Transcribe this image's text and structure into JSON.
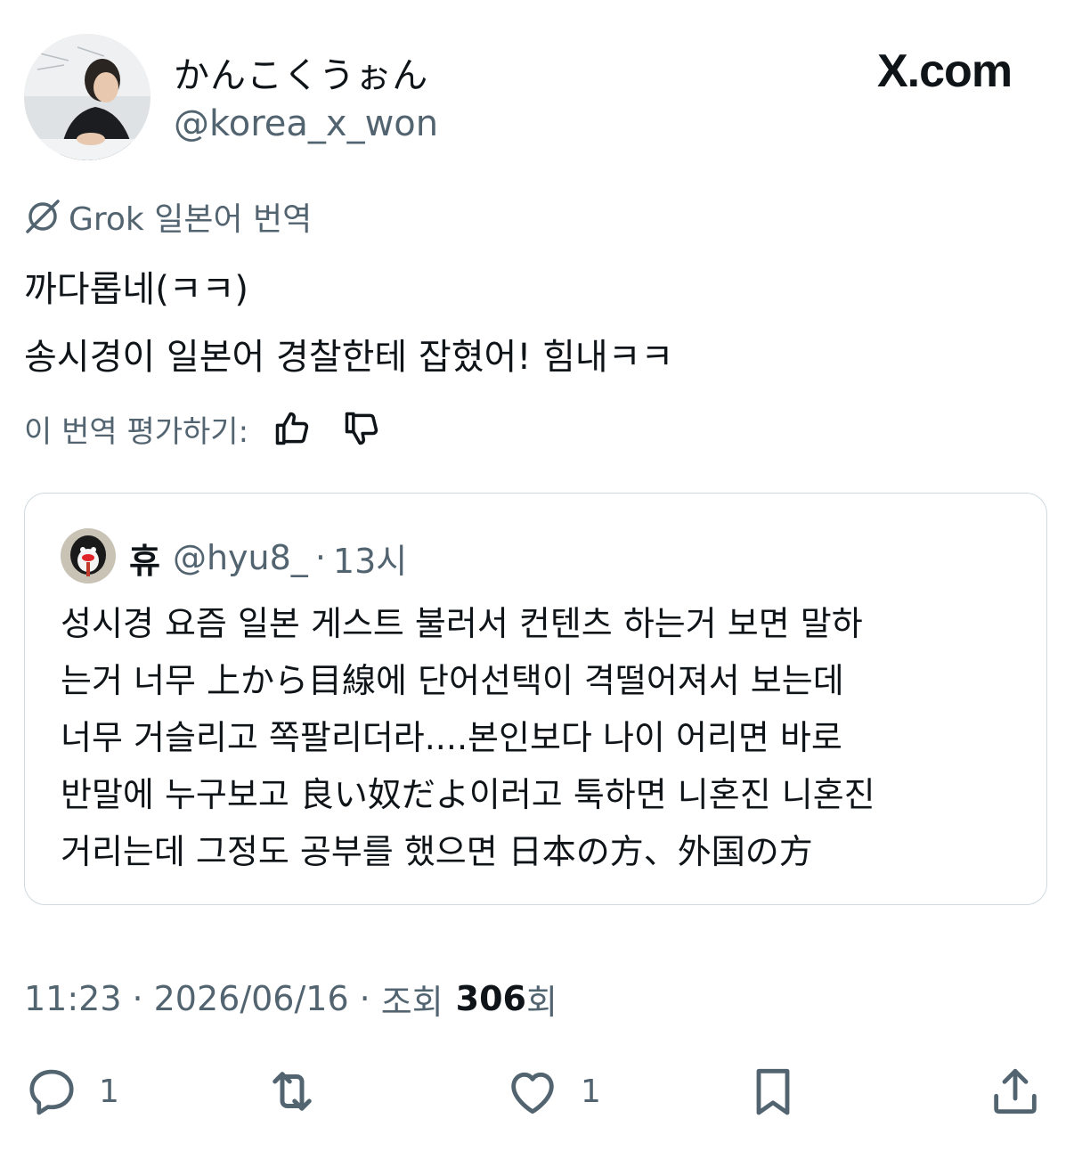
{
  "author": {
    "display_name": "かんこくうぉん",
    "handle": "@korea_x_won"
  },
  "brand": {
    "logo_text": "X.com"
  },
  "translation": {
    "label": "Grok 일본어 번역",
    "lines": [
      "까다롭네(ㅋㅋ)",
      "송시경이 일본어 경찰한테 잡혔어! 힘내ㅋㅋ"
    ],
    "rate_prompt": "이 번역 평가하기:"
  },
  "quote": {
    "name": "휴",
    "handle": "@hyu8_",
    "dot": "·",
    "time": "13시",
    "lines": [
      "성시경 요즘 일본 게스트 불러서 컨텐츠 하는거 보면 말하",
      "는거 너무 上から目線에 단어선택이 격떨어져서 보는데",
      "너무 거슬리고 쪽팔리더라....본인보다 나이 어리면 바로",
      "반말에 누구보고 良い奴だよ이러고 툭하면 니혼진 니혼진",
      "거리는데 그정도 공부를 했으면 日本の方、外国の方"
    ]
  },
  "meta": {
    "time": "11:23",
    "sep": "·",
    "date": "2026/06/16",
    "views_label": "조회",
    "views_count": "306",
    "views_suffix": "회"
  },
  "actions": {
    "reply_count": "1",
    "like_count": "1"
  },
  "colors": {
    "text": "#0f1419",
    "secondary": "#536471",
    "border": "#cfd9de"
  }
}
